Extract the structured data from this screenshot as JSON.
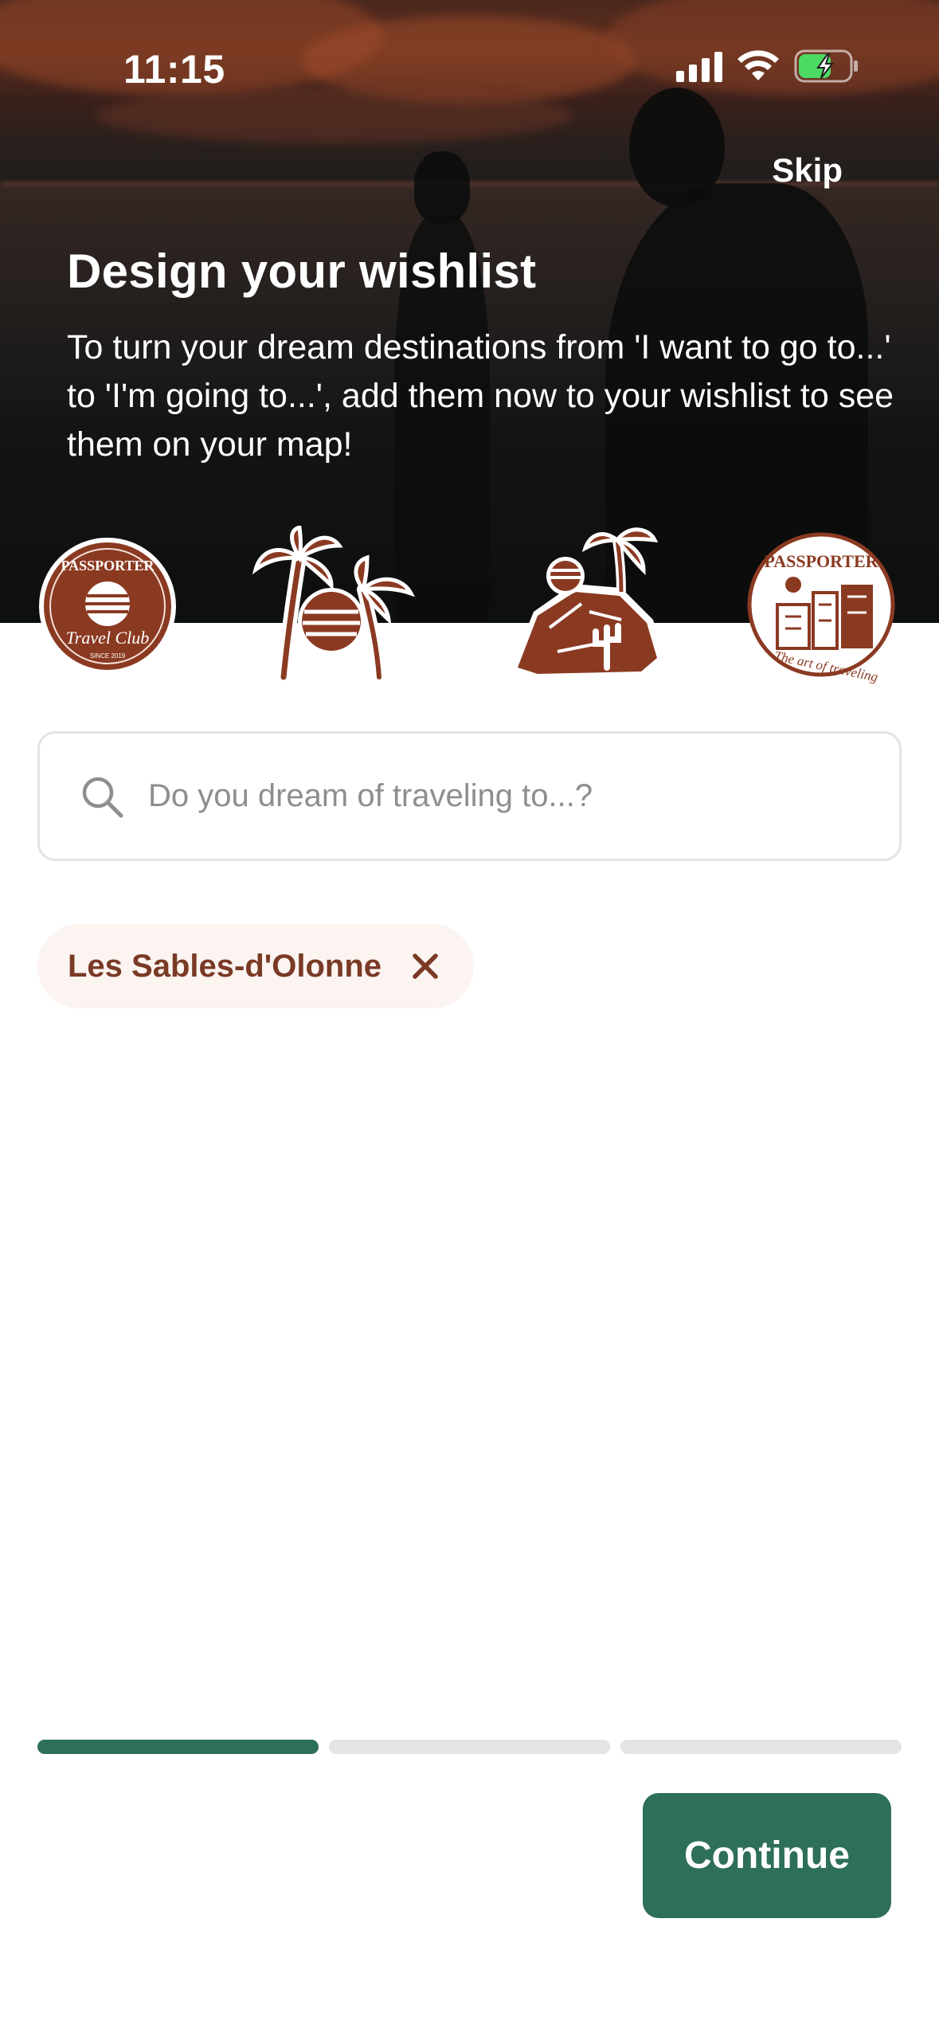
{
  "status_bar": {
    "time": "11:15",
    "icons": [
      "cellular-signal-icon",
      "wifi-icon",
      "battery-charging-icon"
    ]
  },
  "header": {
    "skip_label": "Skip",
    "title": "Design your wishlist",
    "subtitle": "To turn your dream destinations from 'I want to go to...' to 'I'm going to...', add them now to your wishlist to see them on your map!"
  },
  "stickers": {
    "travel_club_badge": {
      "text": "PASSPORTER",
      "script": "Travel Club",
      "since": "SINCE 2019"
    },
    "palm_globe": {},
    "desert_cactus": {},
    "passporter_town": {
      "text": "PASSPORTER",
      "script": "The art of traveling"
    }
  },
  "search": {
    "placeholder": "Do you dream of traveling to...?",
    "value": ""
  },
  "selected_destinations": [
    {
      "label": "Les Sables-d'Olonne"
    }
  ],
  "progress": {
    "current_step": 1,
    "total_steps": 3
  },
  "footer": {
    "continue_label": "Continue"
  },
  "colors": {
    "primary_green": "#2d6f58",
    "brand_brown": "#8b3a22",
    "chip_bg": "#fbf4f1",
    "chip_text": "#7a3a26",
    "progress_inactive": "#e4e4e2"
  }
}
